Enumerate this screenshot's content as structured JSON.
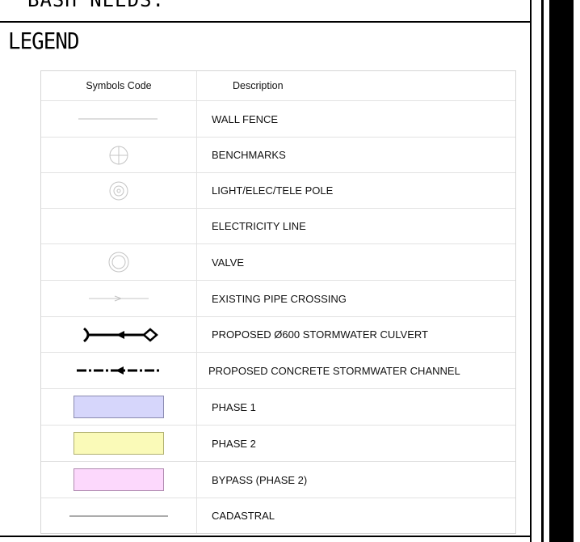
{
  "top_strip": {
    "text": "BASH NEEDS:"
  },
  "legend": {
    "title": "LEGEND",
    "headers": {
      "symbol": "Symbols Code",
      "description": "Description"
    },
    "rows": [
      {
        "symbol": "wall-fence-line-icon",
        "description": "WALL FENCE"
      },
      {
        "symbol": "benchmark-icon",
        "description": "BENCHMARKS"
      },
      {
        "symbol": "pole-icon",
        "description": "LIGHT/ELEC/TELE POLE"
      },
      {
        "symbol": "",
        "description": "ELECTRICITY LINE"
      },
      {
        "symbol": "valve-icon",
        "description": "VALVE"
      },
      {
        "symbol": "pipe-crossing-icon",
        "description": "EXISTING PIPE CROSSING"
      },
      {
        "symbol": "culvert-icon",
        "description": "PROPOSED Ø600 STORMWATER CULVERT"
      },
      {
        "symbol": "channel-icon",
        "description": "PROPOSED CONCRETE STORMWATER CHANNEL"
      },
      {
        "symbol": "phase1-swatch",
        "description": "PHASE 1",
        "fill": "#d6d6fb",
        "stroke": "#8a8ab0"
      },
      {
        "symbol": "phase2-swatch",
        "description": "PHASE 2",
        "fill": "#fafab8",
        "stroke": "#b0b070"
      },
      {
        "symbol": "bypass-swatch",
        "description": "BYPASS (PHASE 2)",
        "fill": "#fcd8fc",
        "stroke": "#b08ab0"
      },
      {
        "symbol": "cadastral-line-icon",
        "description": "CADASTRAL"
      }
    ]
  }
}
